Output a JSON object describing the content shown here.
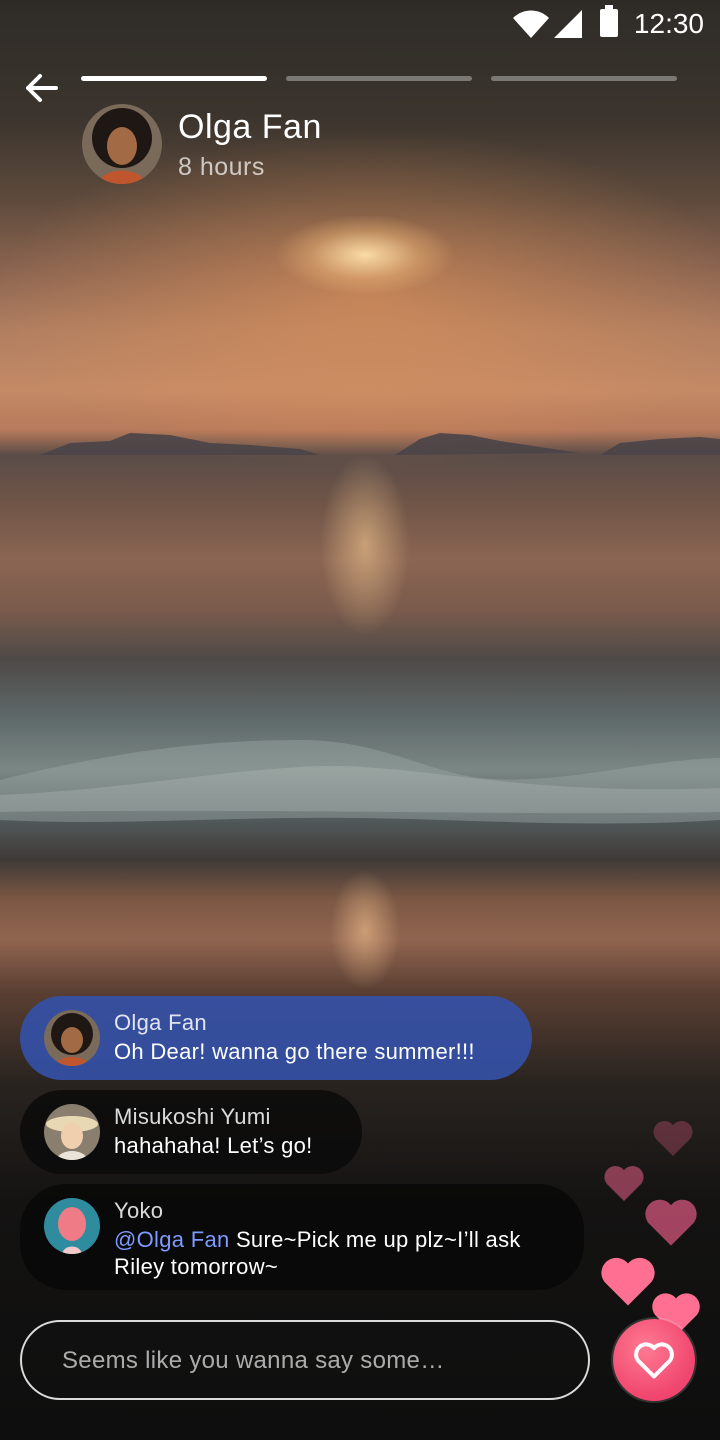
{
  "status_bar": {
    "time": "12:30",
    "icons": [
      "wifi-icon",
      "signal-icon",
      "battery-icon"
    ]
  },
  "story": {
    "progress": [
      1.0,
      0.0,
      0.0
    ],
    "author_name": "Olga Fan",
    "posted_ago": "8 hours",
    "back_icon": "arrow-left-icon"
  },
  "comments": [
    {
      "name": "Olga Fan",
      "text": "Oh Dear! wanna go there summer!!!",
      "highlighted": true
    },
    {
      "name": "Misukoshi Yumi",
      "text": "hahahaha! Let’s go!"
    },
    {
      "name": "Yoko",
      "mention": "@Olga Fan",
      "text": " Sure~Pick me up plz~I’ll ask Riley tomorrow~"
    }
  ],
  "composer": {
    "placeholder": "Seems like you wanna say some…",
    "like_icon": "heart-icon"
  },
  "colors": {
    "highlight_bubble": "#3450a6",
    "mention": "#7d9bff",
    "like": "#f0456e"
  }
}
